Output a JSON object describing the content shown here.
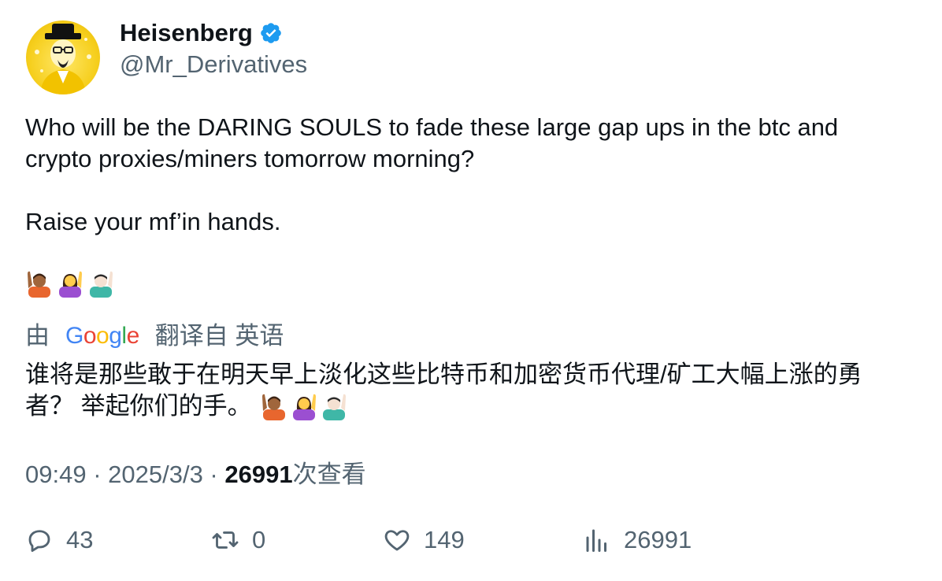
{
  "author": {
    "display_name": "Heisenberg",
    "handle": "@Mr_Derivatives",
    "verified": true,
    "avatar_icon": "heisenberg-avatar"
  },
  "tweet": {
    "line1": "Who will be the DARING SOULS to fade these large gap ups in the btc and crypto proxies/miners tomorrow morning?",
    "line2": "Raise your mf’in hands.",
    "emojis": [
      "person-raising-hand-medium-dark",
      "woman-raising-hand",
      "man-raising-hand-light"
    ]
  },
  "translation": {
    "by_label": "由",
    "provider": "Google",
    "from_label": "翻译自 英语",
    "text": "谁将是那些敢于在明天早上淡化这些比特币和加密货币代理/矿工大幅上涨的勇者？ 举起你们的手。 "
  },
  "meta": {
    "time": "09:49",
    "separator": " · ",
    "date": "2025/3/3",
    "views_count": "26991",
    "views_label": "次查看"
  },
  "actions": {
    "replies": "43",
    "retweets": "0",
    "likes": "149",
    "views": "26991"
  },
  "colors": {
    "text_primary": "#0f1419",
    "text_secondary": "#536471",
    "verified_blue": "#1d9bf0"
  }
}
